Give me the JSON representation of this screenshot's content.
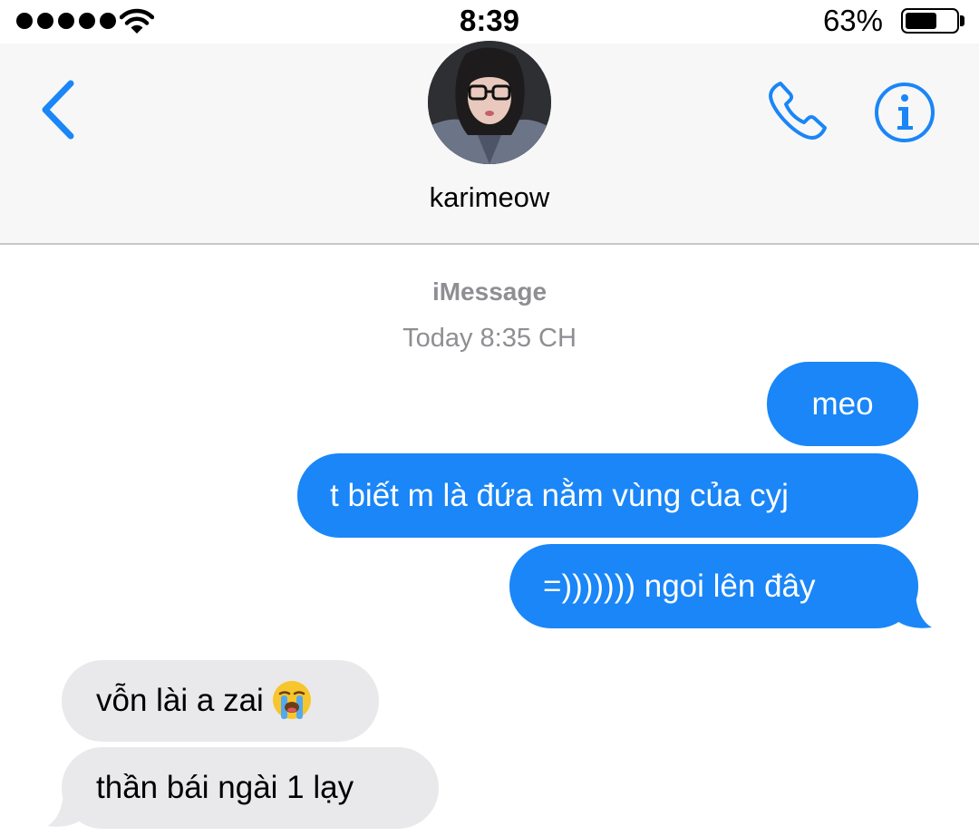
{
  "status_bar": {
    "time": "8:39",
    "battery_percent": "63%",
    "battery_level": 0.63,
    "signal_bars": 5
  },
  "header": {
    "contact_name": "karimeow",
    "back_icon": "chevron-left-icon",
    "call_icon": "phone-icon",
    "info_icon": "info-circle-icon",
    "accent_color": "#1a86f7"
  },
  "conversation": {
    "service": "iMessage",
    "timestamp": "Today 8:35 CH",
    "messages": [
      {
        "direction": "outgoing",
        "text": "meo"
      },
      {
        "direction": "outgoing",
        "text": "t biết m là đứa nằm vùng của cyj"
      },
      {
        "direction": "outgoing",
        "text": "=))))))) ngoi lên đây"
      },
      {
        "direction": "incoming",
        "text": "vỗn lài a zai",
        "emoji": "loudly-crying-face-icon"
      },
      {
        "direction": "incoming",
        "text": "thần bái ngài 1 lạy"
      }
    ],
    "outgoing_color": "#1a86f7",
    "incoming_color": "#e9e9eb"
  }
}
